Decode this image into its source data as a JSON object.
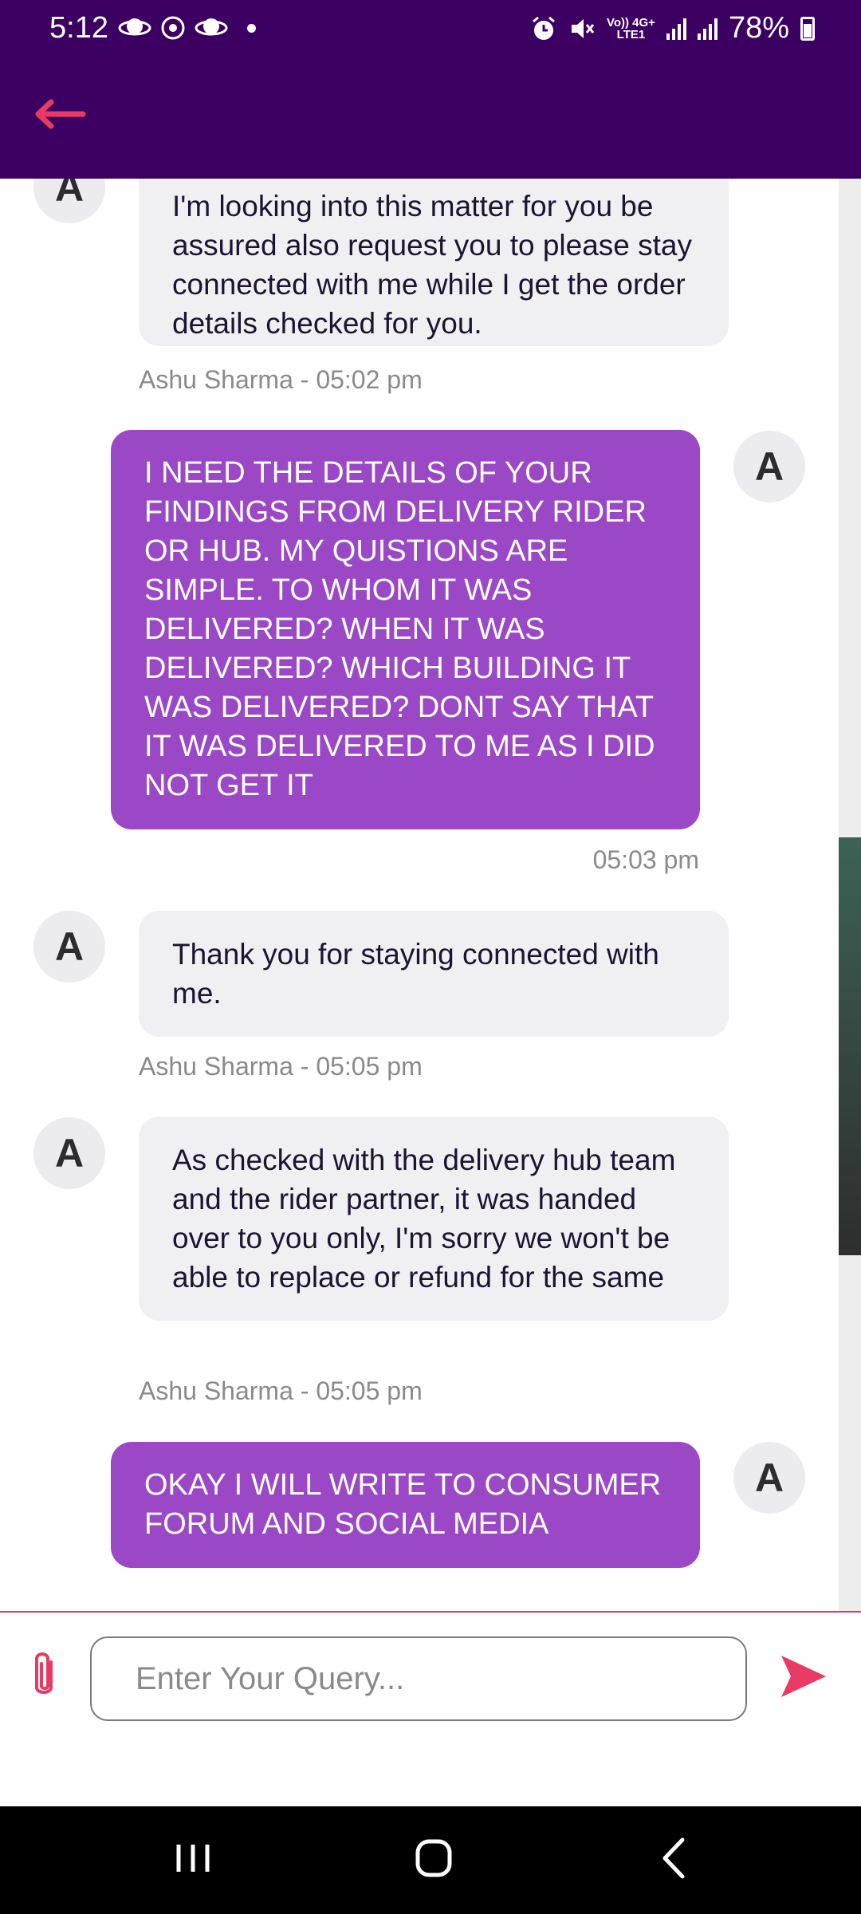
{
  "status_bar": {
    "time": "5:12",
    "network_top": "Vo)) 4G+",
    "network_bottom": "LTE1",
    "battery": "78%"
  },
  "header": {
    "back_icon": "back-arrow-icon",
    "accent_color": "#e83a64",
    "background": "#3b0061"
  },
  "messages": [
    {
      "sender": "agent",
      "avatar": "A",
      "text": "I'm looking into this matter for you be assured also request you to please stay connected with me while I get the order details checked for you.",
      "meta": "Ashu Sharma - 05:02 pm"
    },
    {
      "sender": "user",
      "avatar": "A",
      "text": "I NEED THE DETAILS OF YOUR FINDINGS FROM DELIVERY RIDER OR HUB. MY QUISTIONS ARE SIMPLE. TO WHOM IT WAS DELIVERED? WHEN IT WAS DELIVERED? WHICH BUILDING IT WAS DELIVERED? DONT SAY THAT IT WAS DELIVERED TO ME AS I DID NOT GET IT",
      "meta": "05:03 pm"
    },
    {
      "sender": "agent",
      "avatar": "A",
      "text": "Thank you for staying connected with me.",
      "meta": "Ashu Sharma - 05:05 pm"
    },
    {
      "sender": "agent",
      "avatar": "A",
      "text": "As checked with the delivery hub team and the rider partner, it was handed over to you only, I'm sorry we won't be able to replace or refund for the same",
      "meta": "Ashu Sharma - 05:05 pm"
    },
    {
      "sender": "user",
      "avatar": "A",
      "text": "OKAY I WILL WRITE TO CONSUMER FORUM AND SOCIAL MEDIA"
    }
  ],
  "composer": {
    "placeholder": "Enter Your Query...",
    "attach_icon": "paperclip-icon",
    "send_icon": "send-icon"
  },
  "colors": {
    "user_bubble": "#9a48c6",
    "agent_bubble": "#f0f0f2",
    "accent": "#e83a64"
  }
}
